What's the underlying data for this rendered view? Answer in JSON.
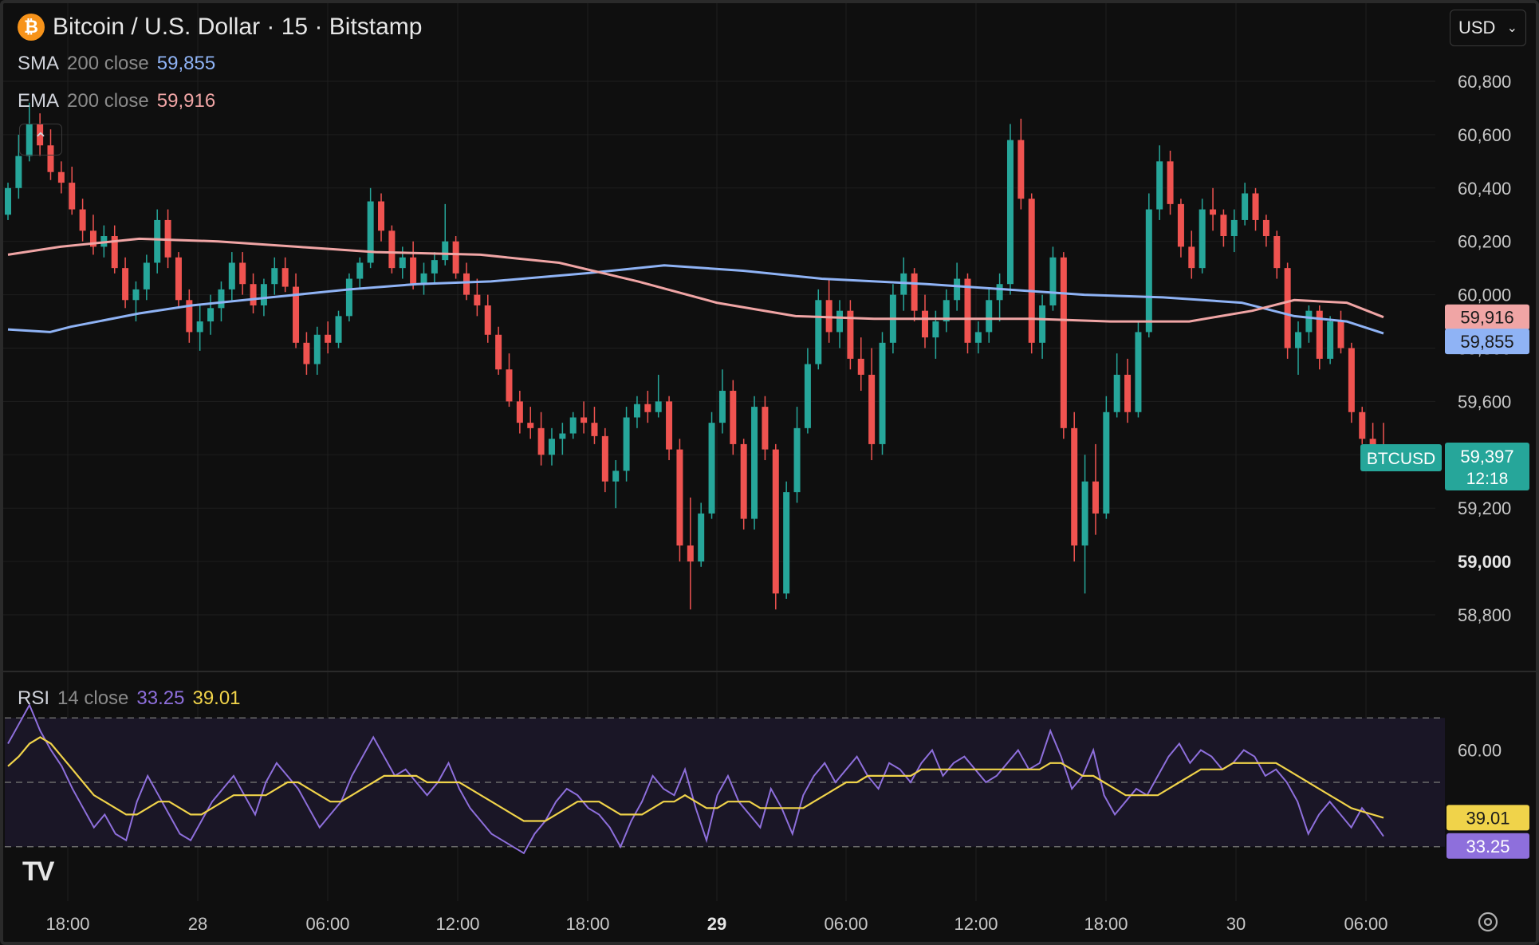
{
  "header": {
    "symbol_icon": "bitcoin-icon",
    "title": "Bitcoin / U.S. Dollar · 15 · Bitstamp",
    "currency": "USD"
  },
  "indicators": {
    "sma": {
      "name": "SMA",
      "params": "200 close",
      "value": "59,855",
      "color": "#8fb3f5"
    },
    "ema": {
      "name": "EMA",
      "params": "200 close",
      "value": "59,916",
      "color": "#f0a5a5"
    },
    "rsi": {
      "name": "RSI",
      "params": "14 close",
      "value": "33.25",
      "ma_value": "39.01",
      "color": "#8e6fdc",
      "ma_color": "#f0d34a"
    }
  },
  "colors": {
    "up": "#26a69a",
    "down": "#ef5350",
    "background": "#0f0f0f",
    "grid": "#1f1f1f"
  },
  "price_tags": {
    "symbol_label": "BTCUSD",
    "last_price": "59,397",
    "countdown": "12:18"
  },
  "chart_data": [
    {
      "type": "candlestick",
      "title": "Bitcoin / U.S. Dollar · 15 · Bitstamp",
      "x_ticks": [
        "18:00",
        "28",
        "06:00",
        "12:00",
        "18:00",
        "29",
        "06:00",
        "12:00",
        "18:00",
        "30",
        "06:00"
      ],
      "y_ticks": [
        "60,800",
        "60,600",
        "60,400",
        "60,200",
        "60,000",
        "59,800",
        "59,600",
        "59,400",
        "59,200",
        "59,000",
        "58,800"
      ],
      "ylim": [
        58650,
        60900
      ],
      "series": [
        {
          "name": "SMA 200 close",
          "x": [
            0,
            8,
            12,
            25,
            35,
            50,
            65,
            78,
            92,
            110,
            125,
            140,
            155,
            175,
            190,
            205,
            220,
            235,
            245,
            255,
            262
          ],
          "y": [
            59870,
            59860,
            59880,
            59930,
            59960,
            59990,
            60020,
            60040,
            60050,
            60080,
            60110,
            60090,
            60060,
            60040,
            60020,
            60000,
            59990,
            59970,
            59920,
            59900,
            59855
          ]
        },
        {
          "name": "EMA 200 close",
          "x": [
            0,
            10,
            25,
            40,
            55,
            70,
            90,
            105,
            120,
            135,
            150,
            165,
            180,
            195,
            210,
            225,
            237,
            245,
            255,
            262
          ],
          "y": [
            60150,
            60180,
            60210,
            60200,
            60180,
            60160,
            60150,
            60120,
            60050,
            59970,
            59920,
            59910,
            59910,
            59910,
            59900,
            59900,
            59940,
            59980,
            59970,
            59916
          ]
        }
      ],
      "ohlc": [
        [
          60300,
          60420,
          60280,
          60400
        ],
        [
          60400,
          60600,
          60360,
          60520
        ],
        [
          60520,
          60720,
          60500,
          60640
        ],
        [
          60640,
          60680,
          60520,
          60560
        ],
        [
          60560,
          60620,
          60430,
          60460
        ],
        [
          60460,
          60500,
          60380,
          60420
        ],
        [
          60420,
          60480,
          60300,
          60320
        ],
        [
          60320,
          60360,
          60200,
          60240
        ],
        [
          60240,
          60300,
          60150,
          60180
        ],
        [
          60180,
          60260,
          60140,
          60220
        ],
        [
          60220,
          60260,
          60080,
          60100
        ],
        [
          60100,
          60140,
          59950,
          59980
        ],
        [
          59980,
          60050,
          59900,
          60020
        ],
        [
          60020,
          60150,
          59980,
          60120
        ],
        [
          60120,
          60320,
          60080,
          60280
        ],
        [
          60280,
          60320,
          60100,
          60140
        ],
        [
          60140,
          60160,
          59950,
          59980
        ],
        [
          59980,
          60020,
          59820,
          59860
        ],
        [
          59860,
          59960,
          59790,
          59900
        ],
        [
          59900,
          60000,
          59850,
          59950
        ],
        [
          59950,
          60050,
          59900,
          60020
        ],
        [
          60020,
          60160,
          59980,
          60120
        ],
        [
          60120,
          60160,
          60000,
          60040
        ],
        [
          60040,
          60080,
          59930,
          59960
        ],
        [
          59960,
          60060,
          59920,
          60040
        ],
        [
          60040,
          60140,
          60000,
          60100
        ],
        [
          60100,
          60140,
          60010,
          60030
        ],
        [
          60030,
          60080,
          59800,
          59820
        ],
        [
          59820,
          59860,
          59700,
          59740
        ],
        [
          59740,
          59880,
          59700,
          59850
        ],
        [
          59850,
          59900,
          59780,
          59820
        ],
        [
          59820,
          59940,
          59800,
          59920
        ],
        [
          59920,
          60080,
          59900,
          60060
        ],
        [
          60060,
          60140,
          60020,
          60120
        ],
        [
          60120,
          60400,
          60100,
          60350
        ],
        [
          60350,
          60380,
          60200,
          60240
        ],
        [
          60240,
          60260,
          60080,
          60100
        ],
        [
          60100,
          60180,
          60060,
          60140
        ],
        [
          60140,
          60200,
          60020,
          60040
        ],
        [
          60040,
          60120,
          60000,
          60080
        ],
        [
          60080,
          60160,
          60040,
          60130
        ],
        [
          60130,
          60340,
          60110,
          60200
        ],
        [
          60200,
          60220,
          60060,
          60080
        ],
        [
          60080,
          60120,
          59980,
          60000
        ],
        [
          60000,
          60060,
          59920,
          59960
        ],
        [
          59960,
          60000,
          59820,
          59850
        ],
        [
          59850,
          59880,
          59700,
          59720
        ],
        [
          59720,
          59780,
          59580,
          59600
        ],
        [
          59600,
          59640,
          59480,
          59520
        ],
        [
          59520,
          59580,
          59460,
          59500
        ],
        [
          59500,
          59560,
          59360,
          59400
        ],
        [
          59400,
          59500,
          59360,
          59460
        ],
        [
          59460,
          59520,
          59400,
          59480
        ],
        [
          59480,
          59560,
          59460,
          59540
        ],
        [
          59540,
          59600,
          59480,
          59520
        ],
        [
          59520,
          59580,
          59440,
          59470
        ],
        [
          59470,
          59500,
          59260,
          59300
        ],
        [
          59300,
          59380,
          59200,
          59340
        ],
        [
          59340,
          59580,
          59300,
          59540
        ],
        [
          59540,
          59620,
          59500,
          59590
        ],
        [
          59590,
          59640,
          59520,
          59560
        ],
        [
          59560,
          59700,
          59540,
          59600
        ],
        [
          59600,
          59620,
          59380,
          59420
        ],
        [
          59420,
          59460,
          59000,
          59060
        ],
        [
          59060,
          59240,
          58820,
          59000
        ],
        [
          59000,
          59220,
          58980,
          59180
        ],
        [
          59180,
          59560,
          59160,
          59520
        ],
        [
          59520,
          59720,
          59480,
          59640
        ],
        [
          59640,
          59680,
          59400,
          59440
        ],
        [
          59440,
          59460,
          59120,
          59160
        ],
        [
          59160,
          59620,
          59120,
          59580
        ],
        [
          59580,
          59620,
          59380,
          59420
        ],
        [
          59420,
          59440,
          58820,
          58880
        ],
        [
          58880,
          59300,
          58860,
          59260
        ],
        [
          59260,
          59580,
          59220,
          59500
        ],
        [
          59500,
          59800,
          59480,
          59740
        ],
        [
          59740,
          60020,
          59720,
          59980
        ],
        [
          59980,
          60060,
          59820,
          59860
        ],
        [
          59860,
          59980,
          59800,
          59940
        ],
        [
          59940,
          59980,
          59720,
          59760
        ],
        [
          59760,
          59840,
          59640,
          59700
        ],
        [
          59700,
          59800,
          59380,
          59440
        ],
        [
          59440,
          59860,
          59400,
          59820
        ],
        [
          59820,
          60040,
          59780,
          60000
        ],
        [
          60000,
          60140,
          59940,
          60080
        ],
        [
          60080,
          60100,
          59900,
          59940
        ],
        [
          59940,
          60000,
          59800,
          59840
        ],
        [
          59840,
          59940,
          59760,
          59900
        ],
        [
          59900,
          60020,
          59860,
          59980
        ],
        [
          59980,
          60120,
          59940,
          60060
        ],
        [
          60060,
          60080,
          59780,
          59820
        ],
        [
          59820,
          59900,
          59780,
          59860
        ],
        [
          59860,
          60020,
          59820,
          59980
        ],
        [
          59980,
          60080,
          59900,
          60040
        ],
        [
          60040,
          60640,
          60000,
          60580
        ],
        [
          60580,
          60660,
          60320,
          60360
        ],
        [
          60360,
          60380,
          59780,
          59820
        ],
        [
          59820,
          60000,
          59760,
          59960
        ],
        [
          59960,
          60180,
          59940,
          60140
        ],
        [
          60140,
          60160,
          59460,
          59500
        ],
        [
          59500,
          59560,
          59000,
          59060
        ],
        [
          59060,
          59400,
          58880,
          59300
        ],
        [
          59300,
          59440,
          59100,
          59180
        ],
        [
          59180,
          59620,
          59160,
          59560
        ],
        [
          59560,
          59780,
          59540,
          59700
        ],
        [
          59700,
          59760,
          59520,
          59560
        ],
        [
          59560,
          59900,
          59540,
          59860
        ],
        [
          59860,
          60380,
          59840,
          60320
        ],
        [
          60320,
          60560,
          60280,
          60500
        ],
        [
          60500,
          60540,
          60300,
          60340
        ],
        [
          60340,
          60360,
          60140,
          60180
        ],
        [
          60180,
          60240,
          60060,
          60100
        ],
        [
          60100,
          60360,
          60080,
          60320
        ],
        [
          60320,
          60400,
          60240,
          60300
        ],
        [
          60300,
          60320,
          60180,
          60220
        ],
        [
          60220,
          60320,
          60160,
          60280
        ],
        [
          60280,
          60420,
          60260,
          60380
        ],
        [
          60380,
          60400,
          60240,
          60280
        ],
        [
          60280,
          60300,
          60180,
          60220
        ],
        [
          60220,
          60240,
          60060,
          60100
        ],
        [
          60100,
          60120,
          59760,
          59800
        ],
        [
          59800,
          59900,
          59700,
          59860
        ],
        [
          59860,
          59960,
          59820,
          59940
        ],
        [
          59940,
          59960,
          59720,
          59760
        ],
        [
          59760,
          59920,
          59740,
          59900
        ],
        [
          59900,
          59940,
          59780,
          59800
        ],
        [
          59800,
          59820,
          59520,
          59560
        ],
        [
          59560,
          59580,
          59440,
          59460
        ],
        [
          59460,
          59520,
          59400,
          59420
        ],
        [
          59420,
          59520,
          59380,
          59397
        ]
      ]
    },
    {
      "type": "line",
      "title": "RSI 14 close",
      "y_ticks": [
        "60.00"
      ],
      "levels": [
        70,
        50,
        30
      ],
      "ylim": [
        25,
        75
      ],
      "series": [
        {
          "name": "RSI",
          "values": [
            62,
            68,
            74,
            66,
            60,
            55,
            48,
            42,
            36,
            40,
            34,
            32,
            44,
            52,
            46,
            40,
            34,
            32,
            38,
            44,
            48,
            52,
            46,
            40,
            50,
            56,
            52,
            48,
            42,
            36,
            40,
            44,
            52,
            58,
            64,
            58,
            52,
            54,
            50,
            46,
            50,
            56,
            48,
            42,
            38,
            34,
            32,
            30,
            28,
            34,
            38,
            44,
            48,
            46,
            42,
            40,
            36,
            30,
            38,
            44,
            52,
            48,
            46,
            54,
            42,
            32,
            46,
            52,
            44,
            40,
            36,
            48,
            42,
            34,
            46,
            52,
            56,
            50,
            54,
            58,
            52,
            48,
            56,
            54,
            50,
            56,
            60,
            52,
            56,
            58,
            54,
            50,
            52,
            56,
            60,
            54,
            56,
            66,
            58,
            48,
            52,
            60,
            46,
            40,
            44,
            48,
            46,
            52,
            58,
            62,
            56,
            60,
            58,
            54,
            56,
            60,
            58,
            52,
            54,
            50,
            44,
            34,
            40,
            44,
            40,
            36,
            42,
            38,
            33.25
          ]
        },
        {
          "name": "RSI MA",
          "values": [
            55,
            58,
            62,
            64,
            62,
            58,
            54,
            50,
            46,
            44,
            42,
            40,
            40,
            42,
            44,
            44,
            42,
            40,
            40,
            42,
            44,
            46,
            46,
            46,
            46,
            48,
            50,
            50,
            48,
            46,
            44,
            44,
            46,
            48,
            50,
            52,
            52,
            52,
            52,
            50,
            50,
            50,
            50,
            48,
            46,
            44,
            42,
            40,
            38,
            38,
            38,
            40,
            42,
            44,
            44,
            44,
            42,
            40,
            40,
            40,
            42,
            44,
            44,
            46,
            44,
            42,
            42,
            44,
            44,
            44,
            42,
            42,
            42,
            42,
            42,
            44,
            46,
            48,
            50,
            50,
            52,
            52,
            52,
            52,
            52,
            54,
            54,
            54,
            54,
            54,
            54,
            54,
            54,
            54,
            54,
            54,
            54,
            56,
            56,
            54,
            52,
            52,
            50,
            48,
            46,
            46,
            46,
            46,
            48,
            50,
            52,
            54,
            54,
            54,
            56,
            56,
            56,
            56,
            56,
            54,
            52,
            50,
            48,
            46,
            44,
            42,
            41,
            40,
            39.01
          ]
        }
      ]
    }
  ]
}
